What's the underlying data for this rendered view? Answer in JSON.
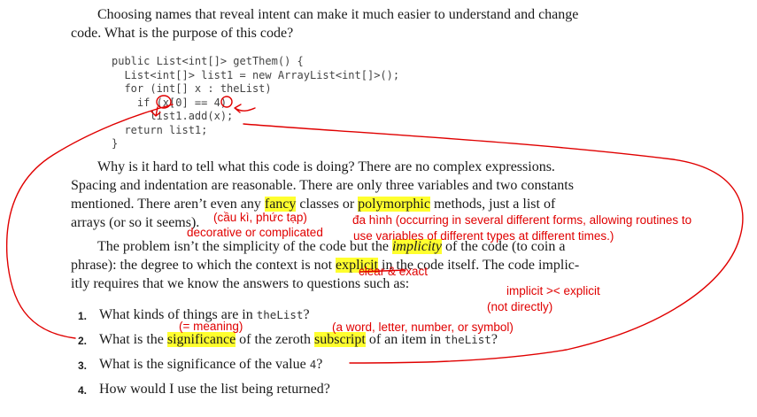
{
  "intro": {
    "line1": "Choosing names that reveal intent can make it much easier to understand and change",
    "line2": "code. What is the purpose of this code?"
  },
  "code": [
    "public List<int[]> getThem() {",
    "  List<int[]> list1 = new ArrayList<int[]>();",
    "  for (int[] x : theList)",
    "    if (x[0] == 4)",
    "      list1.add(x);",
    "  return list1;",
    "}"
  ],
  "para2": {
    "line1": "Why is it hard to tell what this code is doing? There are no complex expressions.",
    "line2": "Spacing and indentation are reasonable. There are only three variables and two constants",
    "line3_a": "mentioned. There aren’t even any ",
    "line3_fancy": "fancy",
    "line3_b": " classes or ",
    "line3_poly": "polymorphic",
    "line3_c": " methods, just a list of",
    "line4": "arrays (or so it seems)."
  },
  "para3": {
    "line1_a": "The problem isn’t the simplicity of the code but the ",
    "line1_implicity": "implicity",
    "line1_b": " of the code (to coin a",
    "line2_a": "phrase): the degree to which the context is not ",
    "line2_explicit": "explicit",
    "line2_b": " in the code itself. The code implic-",
    "line3": "itly requires that we know the answers to questions such as:"
  },
  "list": [
    {
      "num": "1.",
      "pre": "What kinds of things are in ",
      "code": "theList",
      "hl": "",
      "post": "?"
    },
    {
      "num": "2.",
      "pre": "What is the ",
      "hl": "significance",
      "mid": " of the zeroth ",
      "hl2": "subscript",
      "mid2": " of an item in ",
      "code": "theList",
      "post": "?"
    },
    {
      "num": "3.",
      "pre": "What is the significance of the value ",
      "code": "4",
      "post": "?"
    },
    {
      "num": "4.",
      "pre": "How would I use the list being returned?"
    }
  ],
  "annotations": {
    "fancy_vi": "(cầu kì, phức tạp)",
    "fancy_en": "decorative or complicated",
    "poly_vi": "đa hình (occurring in several different forms, allowing routines to",
    "poly_en": "use variables of different types at different times.)",
    "explicit_en": "clear & exact",
    "implicit_vs": "implicit >< explicit",
    "not_directly": "(not directly)",
    "meaning": "(= meaning)",
    "subscript_def": "(a word, letter, number, or symbol)"
  }
}
